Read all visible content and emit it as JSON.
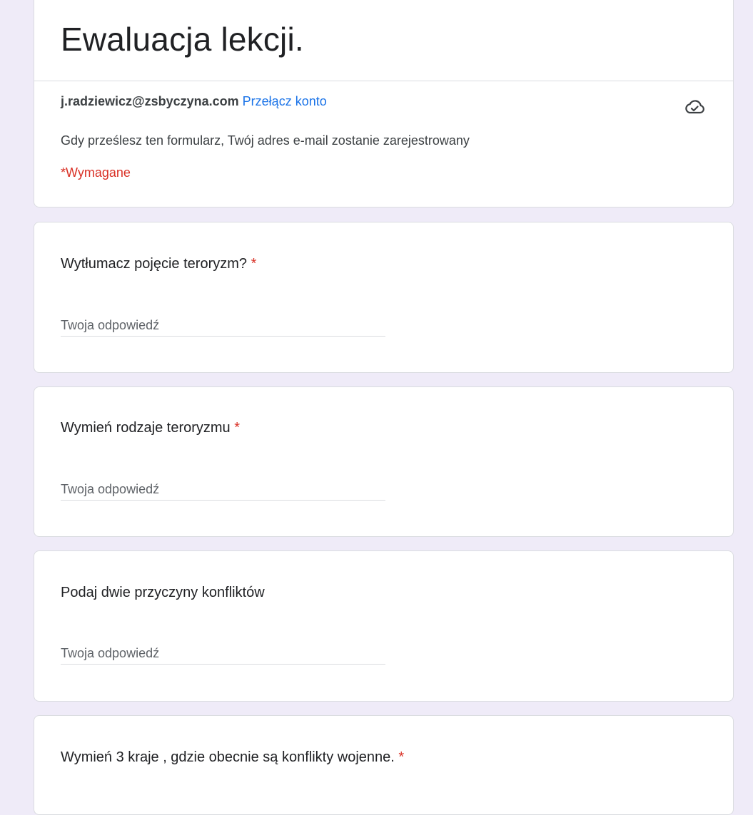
{
  "form": {
    "title": "Ewaluacja lekcji.",
    "account_email": "j.radziewicz@zsbyczyna.com",
    "switch_account": "Przełącz konto",
    "email_note": "Gdy prześlesz ten formularz, Twój adres e-mail zostanie zarejestrowany",
    "required_note": "*Wymagane",
    "draft_icon": "cloud-check-icon"
  },
  "questions": [
    {
      "label": "Wytłumacz pojęcie teroryzm?",
      "required_mark": "*",
      "placeholder": "Twoja odpowiedź"
    },
    {
      "label": "Wymień rodzaje teroryzmu",
      "required_mark": "*",
      "placeholder": "Twoja odpowiedź"
    },
    {
      "label": "Podaj dwie przyczyny konfliktów",
      "required_mark": "",
      "placeholder": "Twoja odpowiedź"
    },
    {
      "label": "Wymień 3 kraje , gdzie obecnie są konflikty wojenne.",
      "required_mark": "*"
    }
  ],
  "colors": {
    "page_background": "#efebf8",
    "link": "#1a73e8",
    "required": "#d93025"
  }
}
